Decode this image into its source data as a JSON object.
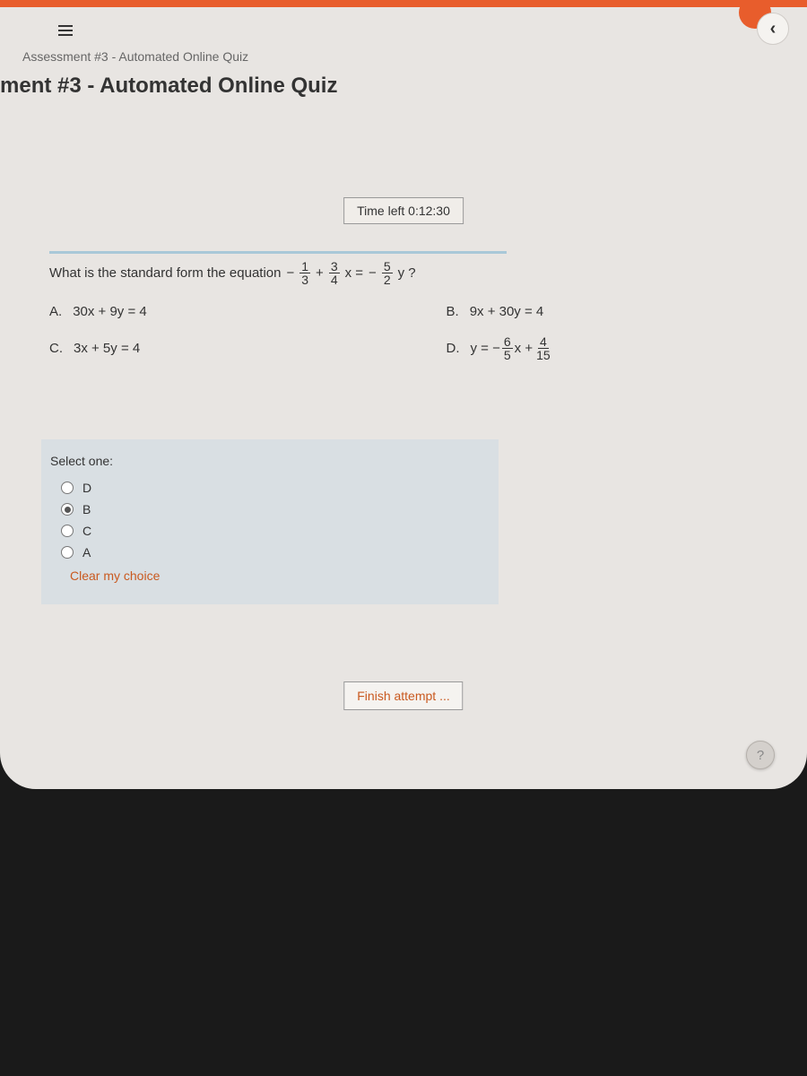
{
  "breadcrumb": "Assessment #3 - Automated Online Quiz",
  "page_title": "ment #3 - Automated Online Quiz",
  "timer": {
    "label": "Time left 0:12:30"
  },
  "question": {
    "prompt": "What is the  standard form the equation",
    "eq_parts": {
      "minus": "−",
      "f1_num": "1",
      "f1_den": "3",
      "plus": "+",
      "f2_num": "3",
      "f2_den": "4",
      "x_eq": "x =",
      "neg": "−",
      "f3_num": "5",
      "f3_den": "2",
      "tail": "y ?"
    },
    "options": {
      "A": {
        "label": "A.",
        "text": "30x + 9y = 4"
      },
      "B": {
        "label": "B.",
        "text": "9x + 30y = 4"
      },
      "C": {
        "label": "C.",
        "text": "3x + 5y = 4"
      },
      "D": {
        "label": "D.",
        "parts": {
          "pre": "y = −",
          "f1_num": "6",
          "f1_den": "5",
          "mid": "x +",
          "f2_num": "4",
          "f2_den": "15"
        }
      }
    }
  },
  "select": {
    "title": "Select one:",
    "choices": [
      "D",
      "B",
      "C",
      "A"
    ],
    "selected": "B",
    "clear_label": "Clear my choice"
  },
  "buttons": {
    "finish": "Finish attempt ..."
  },
  "help": "?"
}
